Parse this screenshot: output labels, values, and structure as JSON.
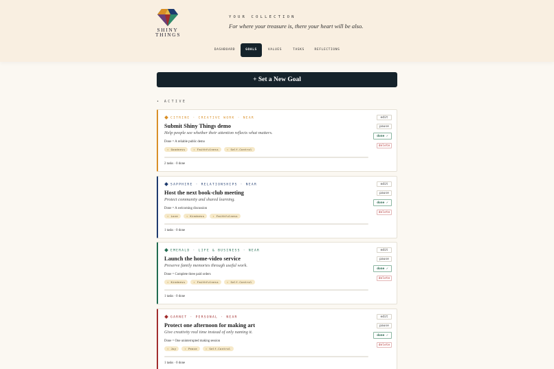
{
  "brand": {
    "logo_line1": "SHINY",
    "logo_line2": "THINGS"
  },
  "header": {
    "collection_label": "YOUR COLLECTION",
    "tagline": "For where your treasure is, there your heart will be also."
  },
  "nav": [
    {
      "label": "DASHBOARD",
      "active": false
    },
    {
      "label": "GOALS",
      "active": true
    },
    {
      "label": "VALUES",
      "active": false
    },
    {
      "label": "TASKS",
      "active": false
    },
    {
      "label": "REFLECTIONS",
      "active": false
    }
  ],
  "new_goal_button": "+ Set a New Goal",
  "section_label": "• ACTIVE",
  "buttons": {
    "edit": "edit",
    "pause": "pause",
    "done": "done ✓",
    "delete": "delete"
  },
  "goals": [
    {
      "meta": "CITRINE · CREATIVE WORK · NEAR",
      "gem_color": "#d98e25",
      "title": "Submit Shiny Things demo",
      "subtitle": "Help people see whether their attention reflects what matters.",
      "done_def": "Done = A reliable public demo",
      "virtues": [
        "Goodness",
        "Faithfulness",
        "Self-Control"
      ],
      "progress": 0,
      "count": "2 tasks · 0 done"
    },
    {
      "meta": "SAPPHIRE · RELATIONSHIPS · NEAR",
      "gem_color": "#1d3a6e",
      "title": "Host the next book-club meeting",
      "subtitle": "Protect community and shared learning.",
      "done_def": "Done = A welcoming discussion",
      "virtues": [
        "Love",
        "Kindness",
        "Faithfulness"
      ],
      "progress": 0,
      "count": "1 tasks · 0 done"
    },
    {
      "meta": "EMERALD · LIFE & BUSINESS · NEAR",
      "gem_color": "#1f6b4f",
      "title": "Launch the home-video service",
      "subtitle": "Preserve family memories through useful work.",
      "done_def": "Done = Complete three paid orders",
      "virtues": [
        "Kindness",
        "Faithfulness",
        "Self-Control"
      ],
      "progress": 0,
      "count": "1 tasks · 0 done"
    },
    {
      "meta": "GARNET · PERSONAL · NEAR",
      "gem_color": "#a12c2c",
      "title": "Protect one afternoon for making art",
      "subtitle": "Give creativity real time instead of only naming it.",
      "done_def": "Done = One uninterrupted making session",
      "virtues": [
        "Joy",
        "Peace",
        "Self-Control"
      ],
      "progress": 0,
      "count": "1 tasks · 0 done"
    }
  ]
}
